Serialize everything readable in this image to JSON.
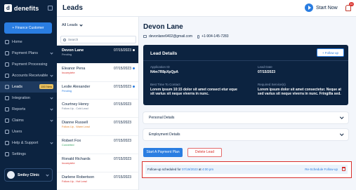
{
  "brand": {
    "name": "denefits",
    "logo": "d"
  },
  "sidebar": {
    "finance_button": "+ Finance Customer",
    "items": [
      {
        "label": "Home",
        "icon": "home-icon"
      },
      {
        "label": "Payment Plans",
        "icon": "card-icon",
        "chevron": true
      },
      {
        "label": "Payment Processing",
        "icon": "processing-icon"
      },
      {
        "label": "Accounts Receivable",
        "icon": "receivable-icon",
        "chevron": true
      },
      {
        "label": "Leads",
        "icon": "leads-icon",
        "active": true,
        "badge": "150 New"
      },
      {
        "label": "Integration",
        "icon": "integration-icon",
        "chevron": true
      },
      {
        "label": "Reports",
        "icon": "reports-icon",
        "chevron": true
      },
      {
        "label": "Claims",
        "icon": "claims-icon",
        "chevron": true
      },
      {
        "label": "Users",
        "icon": "users-icon"
      },
      {
        "label": "Help & Support",
        "icon": "help-icon",
        "chevron": true
      },
      {
        "label": "Settings",
        "icon": "settings-icon"
      }
    ],
    "clinic_name": "Smiley Clinic"
  },
  "header": {
    "title": "Leads",
    "start_now": "Start Now",
    "notification_count": "10"
  },
  "leads": {
    "filter": "All Leads",
    "search_placeholder": "Search",
    "items": [
      {
        "name": "Devon Lane",
        "status": "Pending",
        "status_color": "#b8c4d6",
        "date": "07/15/2023",
        "active": true,
        "dot": true
      },
      {
        "name": "Eleanor Pena",
        "status": "Incomplete",
        "status_color": "#d9302c",
        "date": "07/15/2023",
        "dot": true
      },
      {
        "name": "Leslie Alexander",
        "status": "Pending",
        "status_color": "#2a7de1",
        "date": "07/15/2023",
        "dot": true
      },
      {
        "name": "Courtney Henry",
        "status": "Follow Up - Cold Lead",
        "status_color": "#6b7c93",
        "date": "07/15/2023",
        "dot": false
      },
      {
        "name": "Dianne Russell",
        "status": "Follow Up - Warm Lead",
        "status_color": "#e07b20",
        "date": "07/15/2023",
        "dot": false
      },
      {
        "name": "Robert Fox",
        "status": "Converted",
        "status_color": "#2e9e5b",
        "date": "07/15/2023",
        "dot": false
      },
      {
        "name": "Ronald Richards",
        "status": "Incomplete",
        "status_color": "#d9302c",
        "date": "07/15/2023",
        "dot": false
      },
      {
        "name": "Darlene Robertson",
        "status": "Follow Up - Hot Lead",
        "status_color": "#d9302c",
        "date": "07/15/2023",
        "dot": false
      }
    ]
  },
  "detail": {
    "name": "Devon Lane",
    "email": "devonlane6402@gmail.com",
    "phone": "+1-904-145-7283",
    "card": {
      "title": "Lead Details",
      "follow_up_button": "+ Follow up",
      "application_id_label": "Application ID",
      "application_id": "N4m7R8pXpQpA",
      "lead_date_label": "Lead Date",
      "lead_date": "07/15/2023",
      "best_time_label": "Best Time To Contact",
      "best_time": "Lorem ipsum 10:15 dolor sit amet consect etur eque sit varius sit neque viverra in nunc.",
      "required_services_label": "Required Service(s)",
      "required_services": "Lorem ipsum dolor sit amet consectetur. Neque at sed varius sit neque viverra in nunc. Fringilla sed."
    },
    "personal_details": "Personal Details",
    "employment_details": "Employment Details",
    "start_plan_button": "Start A Payment Plan",
    "delete_lead_button": "Delete Lead",
    "followup": {
      "prefix": "Follow-up scheduled for",
      "date": "07/19/2023",
      "at": "at",
      "time": "4:00 pm",
      "reschedule": "Re-Schedule Follow-up"
    }
  }
}
